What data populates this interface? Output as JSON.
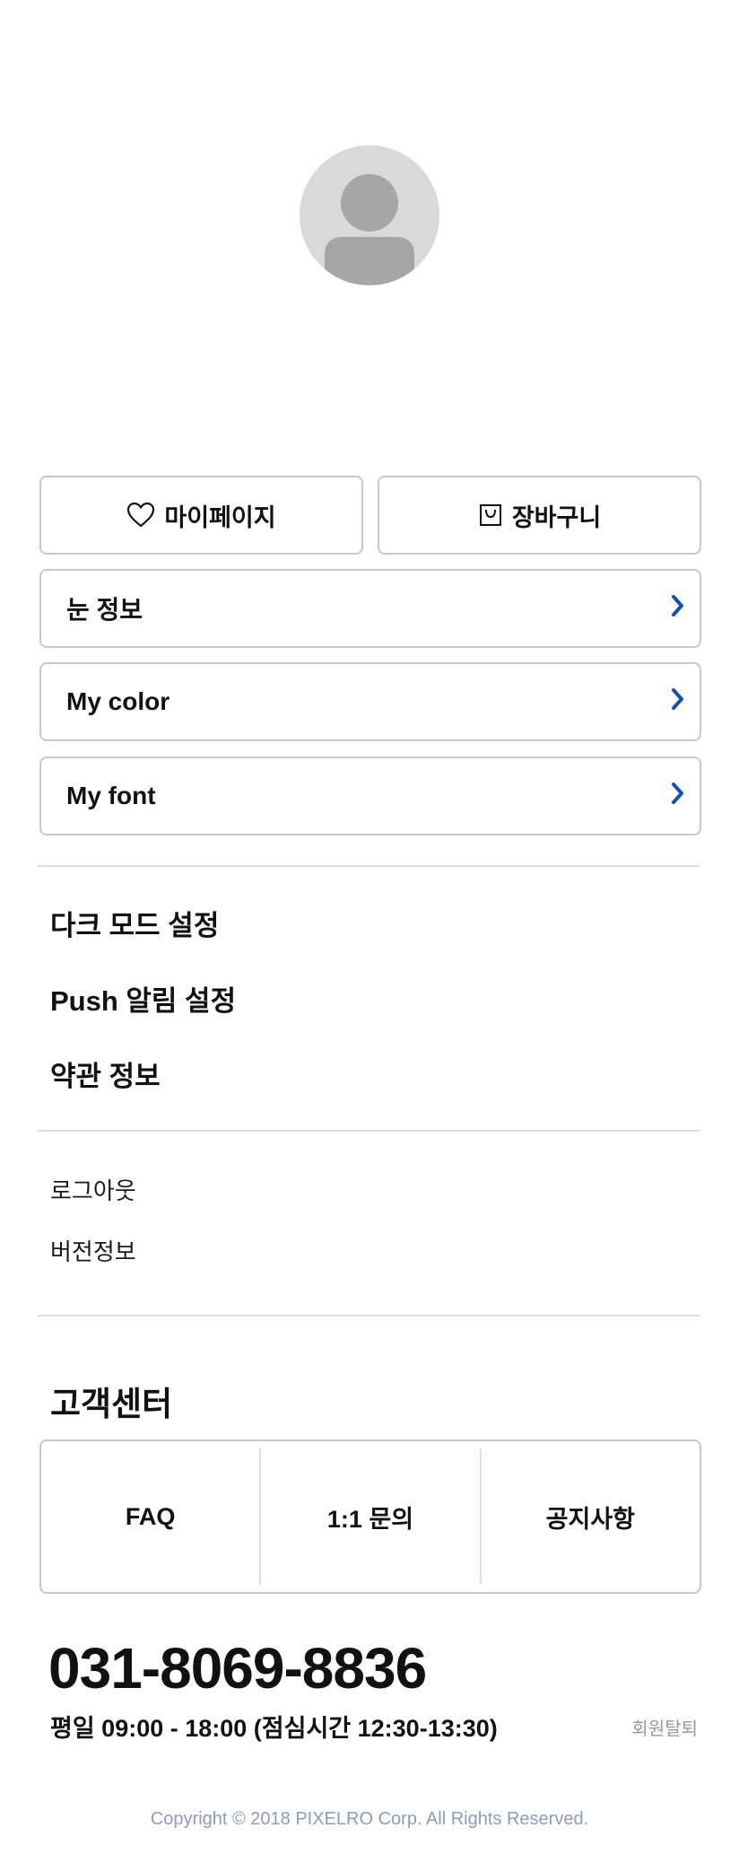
{
  "profile": {
    "avatar_icon": "user-placeholder-icon"
  },
  "quick_buttons": {
    "mypage_label": "마이페이지",
    "mypage_icon": "heart-icon",
    "cart_label": "장바구니",
    "cart_icon": "shopping-bag-icon"
  },
  "menu_rows": [
    {
      "label": "눈 정보",
      "icon": "chevron-right-icon"
    },
    {
      "label": "My color",
      "icon": "chevron-right-icon"
    },
    {
      "label": "My font",
      "icon": "chevron-right-icon"
    }
  ],
  "settings": [
    {
      "label": "다크 모드 설정"
    },
    {
      "label": "Push 알림 설정"
    },
    {
      "label": "약관 정보"
    }
  ],
  "account": {
    "logout_label": "로그아웃",
    "version_label": "버전정보"
  },
  "customer_center": {
    "title": "고객센터",
    "links": [
      {
        "label": "FAQ"
      },
      {
        "label": "1:1 문의"
      },
      {
        "label": "공지사항"
      }
    ],
    "phone": "031-8069-8836",
    "hours": "평일 09:00 - 18:00 (점심시간 12:30-13:30)",
    "withdraw_label": "회원탈퇴"
  },
  "footer": {
    "copyright": "Copyright © 2018 PIXELRO Corp. All Rights Reserved."
  },
  "colors": {
    "accent": "#1450b4",
    "border": "#c8c8c8",
    "divider": "#dedede",
    "avatar_bg": "#d9d9d9",
    "avatar_fg": "#a6a6a6",
    "copyright": "#8f9bb8"
  }
}
